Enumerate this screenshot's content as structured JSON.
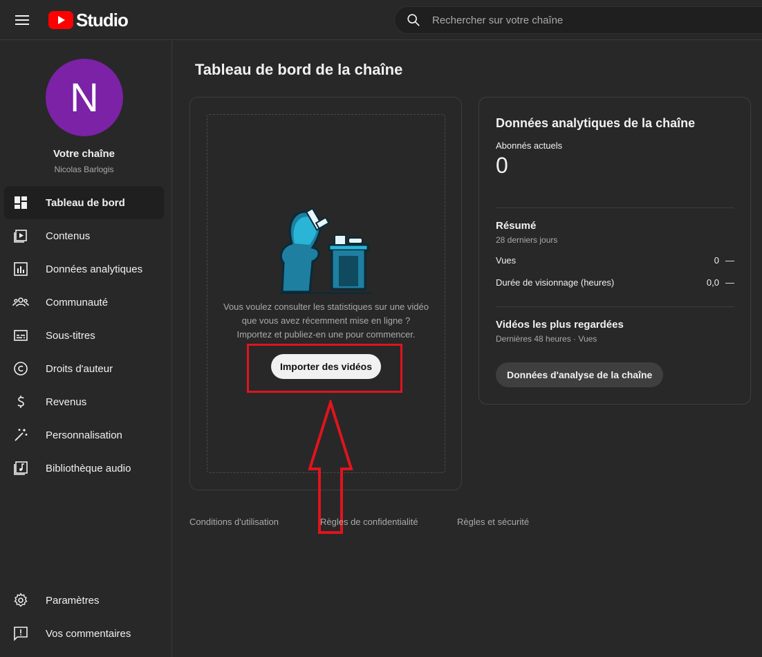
{
  "header": {
    "logo_text": "Studio",
    "search_placeholder": "Rechercher sur votre chaîne"
  },
  "colors": {
    "brand_red": "#ff0000",
    "avatar_bg": "#7b22a6",
    "highlight": "#e0141e"
  },
  "sidebar": {
    "avatar_letter": "N",
    "channel_title": "Votre chaîne",
    "channel_name": "Nicolas Barlogis",
    "items": [
      {
        "label": "Tableau de bord",
        "icon": "dashboard-icon",
        "active": true
      },
      {
        "label": "Contenus",
        "icon": "content-icon"
      },
      {
        "label": "Données analytiques",
        "icon": "analytics-icon"
      },
      {
        "label": "Communauté",
        "icon": "community-icon"
      },
      {
        "label": "Sous-titres",
        "icon": "subtitles-icon"
      },
      {
        "label": "Droits d'auteur",
        "icon": "copyright-icon"
      },
      {
        "label": "Revenus",
        "icon": "dollar-icon"
      },
      {
        "label": "Personnalisation",
        "icon": "magic-wand-icon"
      },
      {
        "label": "Bibliothèque audio",
        "icon": "audio-library-icon"
      }
    ],
    "bottom_items": [
      {
        "label": "Paramètres",
        "icon": "gear-icon"
      },
      {
        "label": "Vos commentaires",
        "icon": "feedback-icon"
      }
    ]
  },
  "main": {
    "page_title": "Tableau de bord de la chaîne",
    "upload_card": {
      "text_line1": "Vous voulez consulter les statistiques sur une vidéo",
      "text_line2": "que vous avez récemment mise en ligne ?",
      "text_line3": "Importez et publiez-en une pour commencer.",
      "button_label": "Importer des vidéos"
    },
    "analytics_card": {
      "title": "Données analytiques de la chaîne",
      "subscribers_label": "Abonnés actuels",
      "subscribers_count": "0",
      "summary_title": "Résumé",
      "summary_period": "28 derniers jours",
      "metrics": [
        {
          "label": "Vues",
          "value": "0",
          "trend": "—"
        },
        {
          "label": "Durée de visionnage (heures)",
          "value": "0,0",
          "trend": "—"
        }
      ],
      "top_videos_title": "Vidéos les plus regardées",
      "top_videos_sub": "Dernières 48 heures · Vues",
      "button_label": "Données d'analyse de la chaîne"
    }
  },
  "footer": {
    "links": [
      "Conditions d'utilisation",
      "Règles de confidentialité",
      "Règles et sécurité"
    ]
  }
}
